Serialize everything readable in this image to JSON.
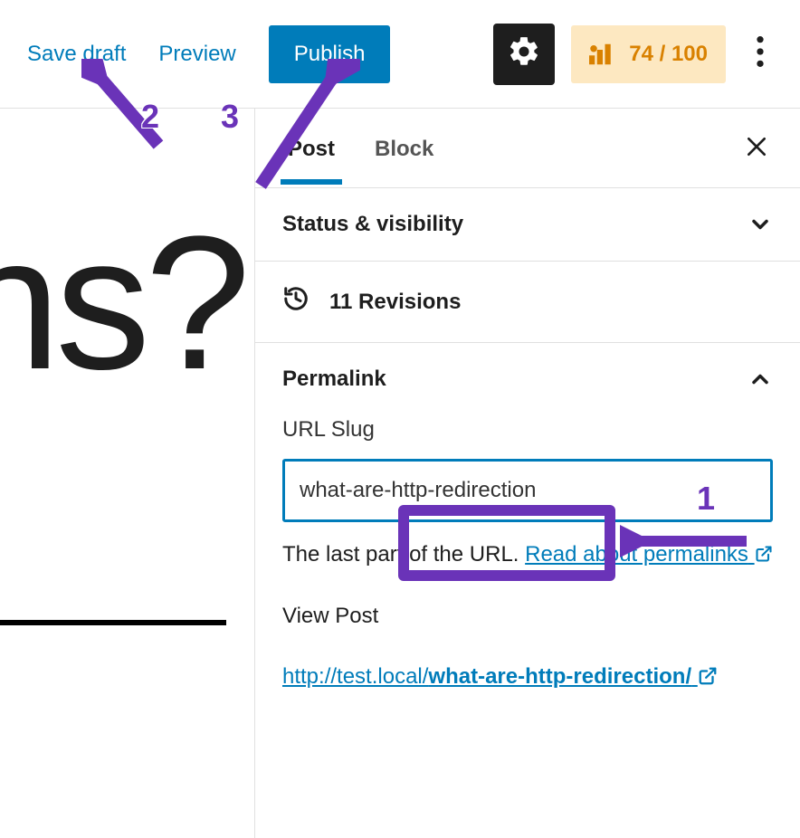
{
  "toolbar": {
    "save_draft": "Save draft",
    "preview": "Preview",
    "publish": "Publish"
  },
  "icons": {
    "settings": "gear-icon",
    "seo_gauge": "gauge-icon",
    "more": "more-vertical-icon",
    "close": "close-icon",
    "chevron_down": "chevron-down-icon",
    "chevron_up": "chevron-up-icon",
    "history": "history-icon",
    "external": "external-link-icon"
  },
  "seo": {
    "score": "74 / 100"
  },
  "editor": {
    "title_visible_fragment": "ns?"
  },
  "sidebar": {
    "tabs": {
      "post": "Post",
      "block": "Block",
      "active": "post"
    },
    "panels": {
      "status_visibility": {
        "title": "Status & visibility",
        "expanded": false
      },
      "revisions": {
        "label": "11 Revisions",
        "count": 11
      },
      "permalink": {
        "title": "Permalink",
        "expanded": true,
        "slug_label": "URL Slug",
        "slug_value": "what-are-http-redirection",
        "help_prefix": "The last part of the URL. ",
        "help_link_text": "Read about permalinks",
        "view_post": "View Post",
        "url_prefix": "http://test.local/",
        "url_slug": "what-are-http-redirection/"
      }
    }
  },
  "annotations": {
    "n1": "1",
    "n2": "2",
    "n3": "3"
  },
  "colors": {
    "wp_blue": "#007cba",
    "badge_bg": "#fde8c1",
    "badge_fg": "#d98100",
    "annotation": "#6a33b8"
  }
}
